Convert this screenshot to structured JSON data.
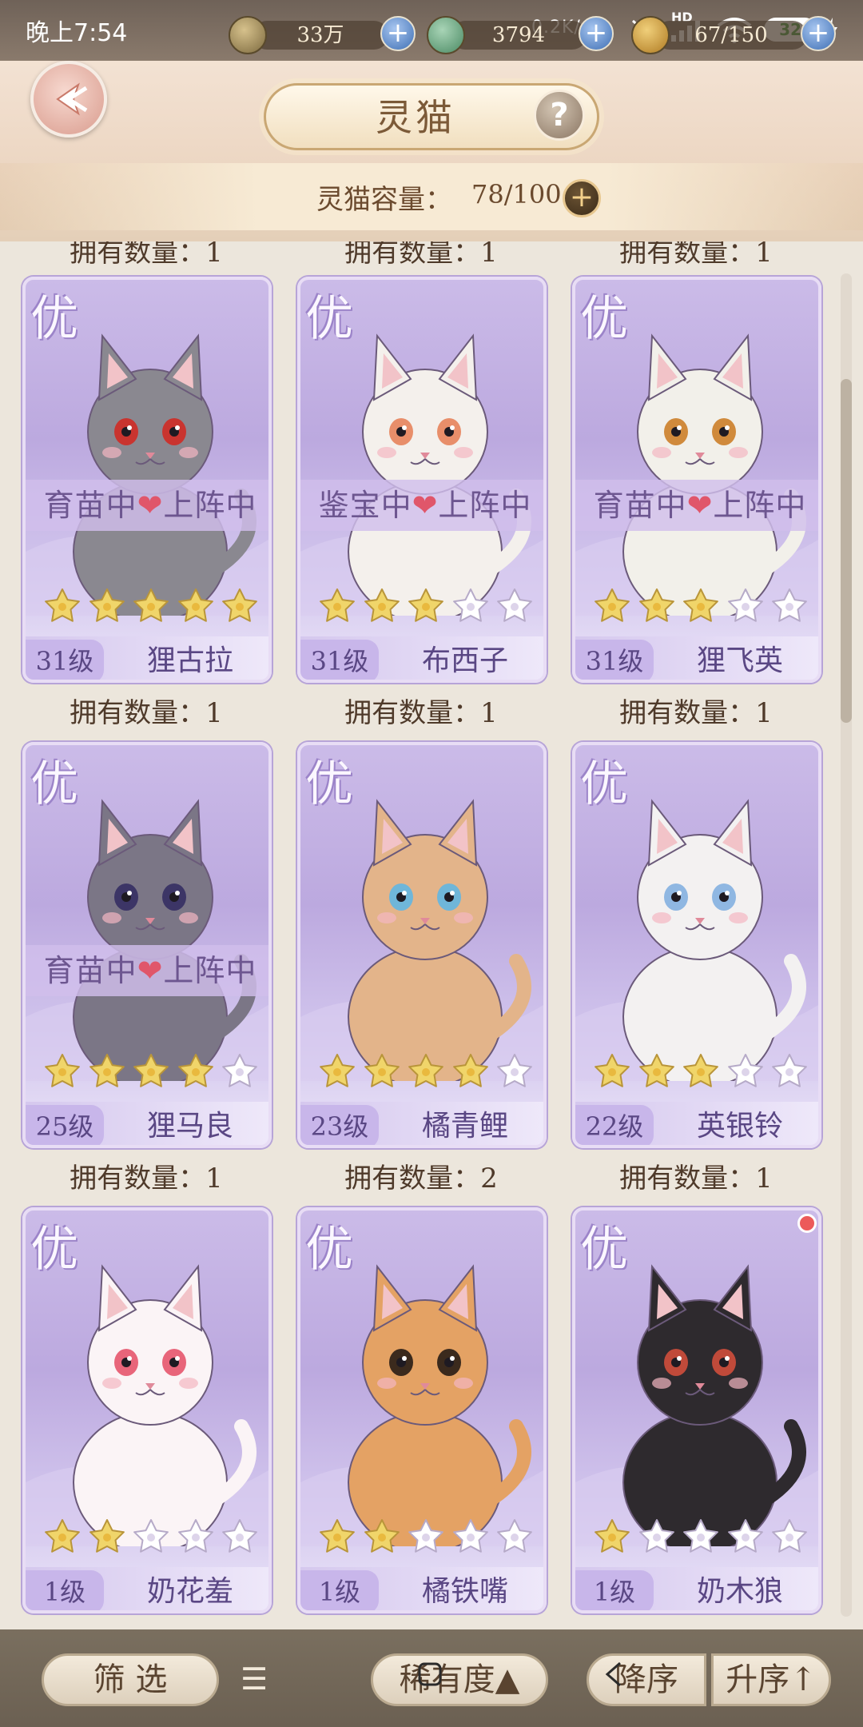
{
  "status_bar": {
    "time": "晚上7:54",
    "network_speed": "0.2K/s",
    "hd": "HD",
    "battery": "32"
  },
  "resources": [
    {
      "icon": "paw-coin-icon",
      "value": "33万"
    },
    {
      "icon": "frog-icon",
      "value": "3794"
    },
    {
      "icon": "gold-icon",
      "value": "67/150"
    }
  ],
  "header": {
    "title": "灵猫",
    "help": "?",
    "capacity_label": "灵猫容量：",
    "capacity_value": "78/100",
    "capacity_plus": "+"
  },
  "partial_row_label": "拥有数量：1",
  "cats": [
    {
      "grade": "优",
      "level": "31级",
      "name": "狸古拉",
      "stars": 5,
      "status": "育苗中❤上阵中",
      "owned": "拥有数量：1",
      "fur": "#8a8890",
      "accent": "#c9342f"
    },
    {
      "grade": "优",
      "level": "31级",
      "name": "布西子",
      "stars": 3,
      "status": "鉴宝中❤上阵中",
      "owned": "拥有数量：1",
      "fur": "#f4f0ec",
      "accent": "#e88e6a"
    },
    {
      "grade": "优",
      "level": "31级",
      "name": "狸飞英",
      "stars": 3,
      "status": "育苗中❤上阵中",
      "owned": "拥有数量：1",
      "fur": "#f2f0ea",
      "accent": "#d08a3c"
    },
    {
      "grade": "优",
      "level": "25级",
      "name": "狸马良",
      "stars": 4,
      "status": "育苗中❤上阵中",
      "owned": "拥有数量：1",
      "fur": "#7b7686",
      "accent": "#3c3566"
    },
    {
      "grade": "优",
      "level": "23级",
      "name": "橘青鲤",
      "stars": 4,
      "status": "",
      "owned": "拥有数量：2",
      "fur": "#e3b48a",
      "accent": "#6fb6d9"
    },
    {
      "grade": "优",
      "level": "22级",
      "name": "英银铃",
      "stars": 3,
      "status": "",
      "owned": "拥有数量：1",
      "fur": "#f3f1f1",
      "accent": "#8fb7e2"
    },
    {
      "grade": "优",
      "level": "1级",
      "name": "奶花羞",
      "stars": 2,
      "status": "",
      "owned": "",
      "fur": "#fbf4f6",
      "accent": "#e8657a"
    },
    {
      "grade": "优",
      "level": "1级",
      "name": "橘铁嘴",
      "stars": 2,
      "status": "",
      "owned": "",
      "fur": "#e4a264",
      "accent": "#3b2a1d"
    },
    {
      "grade": "优",
      "level": "1级",
      "name": "奶木狼",
      "stars": 1,
      "status": "",
      "owned": "",
      "fur": "#2e2a2e",
      "accent": "#c04a3a",
      "new_dot": true
    }
  ],
  "toolbar": {
    "filter": "筛 选",
    "menu": "☰",
    "rarity": "稀有度▲",
    "descend": "降序",
    "ascend": "升序↑"
  },
  "colors": {
    "card_purple": "#bca9df",
    "star_filled": "#f0d56a",
    "star_empty": "#ffffff"
  }
}
